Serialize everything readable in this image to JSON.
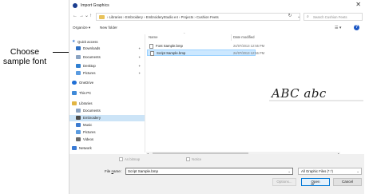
{
  "callout": {
    "line1": "Choose",
    "line2": "sample font"
  },
  "window": {
    "title": "Import Graphics",
    "close_glyph": "✕"
  },
  "nav_buttons": {
    "back": "←",
    "forward": "→",
    "up_menu": "⌄",
    "up": "↑"
  },
  "address": {
    "crumbs": "›  Libraries  ›  Embroidery  ›  EmbroideryStudio e4  ›  Projects  ›  Cushion Feets",
    "chevron": "⌄",
    "refresh": "↻"
  },
  "search": {
    "placeholder": "Search Cushion Feets",
    "icon": "⌕"
  },
  "toolbar": {
    "organize": "Organize ▾",
    "new_folder": "New folder",
    "view": "☰ ▾",
    "help": "?"
  },
  "sidebar": {
    "pin": "✦",
    "items": [
      {
        "label": "Quick access",
        "icon": "star-icon",
        "color": "#3a7bd5"
      },
      {
        "label": "Downloads",
        "icon": "download-icon",
        "color": "#2e6fc4"
      },
      {
        "label": "Documents",
        "icon": "document-icon",
        "color": "#8aa3c2"
      },
      {
        "label": "Desktop",
        "icon": "desktop-icon",
        "color": "#2f7fd1"
      },
      {
        "label": "Pictures",
        "icon": "pictures-icon",
        "color": "#5a9be0"
      },
      {
        "label": "OneDrive",
        "icon": "cloud-icon",
        "color": "#1f6fd6"
      },
      {
        "label": "This PC",
        "icon": "computer-icon",
        "color": "#3f8ad8"
      },
      {
        "label": "Libraries",
        "icon": "libraries-icon",
        "color": "#e2b543"
      },
      {
        "label": "Documents",
        "icon": "document-icon",
        "color": "#8aa3c2"
      },
      {
        "label": "Embroidery",
        "icon": "embroidery-icon",
        "color": "#4a4a4a"
      },
      {
        "label": "Music",
        "icon": "music-icon",
        "color": "#3c7bd0"
      },
      {
        "label": "Pictures",
        "icon": "pictures-icon",
        "color": "#5a9be0"
      },
      {
        "label": "Videos",
        "icon": "video-icon",
        "color": "#6a6a6a"
      },
      {
        "label": "Network",
        "icon": "network-icon",
        "color": "#3a7bd5"
      }
    ]
  },
  "files": {
    "columns": {
      "name": "Name",
      "date": "Date modified",
      "sort": "⌃"
    },
    "rows": [
      {
        "name": "Font Sample.bmp",
        "date": "24/07/2013 12:55 PM"
      },
      {
        "name": "Script Sample.bmp",
        "date": "24/07/2013 12:56 PM"
      }
    ]
  },
  "scroll": {
    "left": "◂",
    "right": "▸"
  },
  "preview": {
    "text": "ABC abc"
  },
  "options": {
    "as_bitmap": "As bitmap",
    "notice": "Notice"
  },
  "filename": {
    "label_pre": "File ",
    "label_mn": "n",
    "label_post": "ame:",
    "value": "Script Sample.bmp",
    "chevron": "⌄"
  },
  "filetype": {
    "value": "All Graphic Files (*.*)",
    "chevron": "⌄"
  },
  "buttons": {
    "options": "Options...",
    "open_mn": "O",
    "open_rest": "pen",
    "cancel": "Cancel"
  }
}
